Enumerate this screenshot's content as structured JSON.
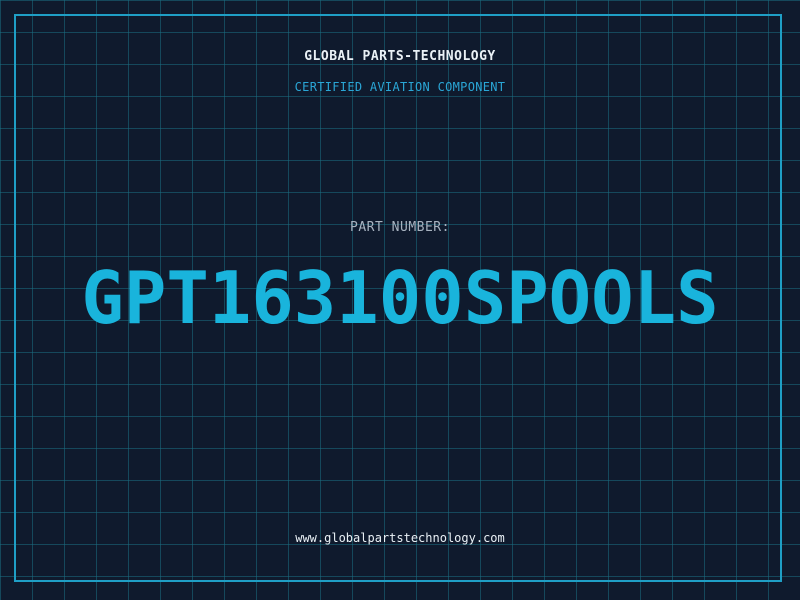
{
  "header": {
    "company": "GLOBAL PARTS-TECHNOLOGY",
    "tagline": "CERTIFIED AVIATION COMPONENT"
  },
  "part": {
    "label": "PART NUMBER:",
    "number": "GPT163100SPOOLS"
  },
  "footer": {
    "website": "www.globalpartstechnology.com"
  },
  "colors": {
    "background": "#0f1a2d",
    "grid": "#1a6e82",
    "frame": "#1f9fc6",
    "accent": "#19b4dc",
    "text": "#eaf1f6",
    "muted": "#a8b3c0"
  }
}
